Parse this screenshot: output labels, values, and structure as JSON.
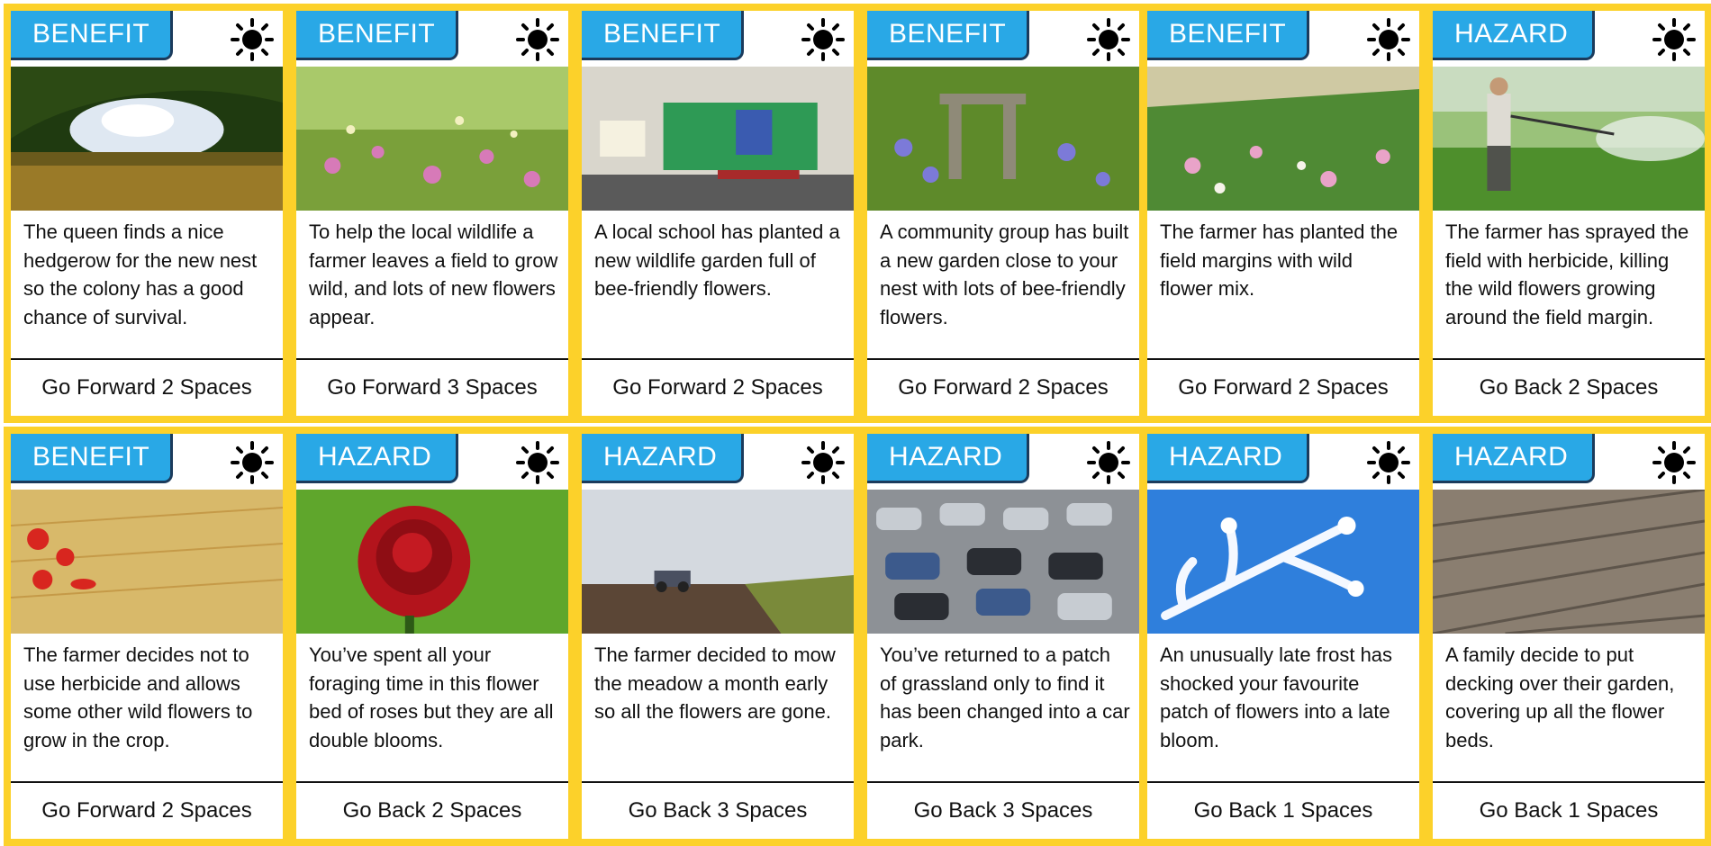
{
  "cards": [
    {
      "type": "BENEFIT",
      "text": "The queen finds a nice hedgerow for the new nest so the colony has a good chance of survival.",
      "action": "Go Forward 2 Spaces",
      "scene": "hedgerow"
    },
    {
      "type": "BENEFIT",
      "text": "To help the local wildlife a farmer leaves a field to grow wild, and lots of new flowers appear.",
      "action": "Go Forward 3 Spaces",
      "scene": "wildflowers"
    },
    {
      "type": "BENEFIT",
      "text": "A local school has planted a new wildlife garden full of bee-friendly flowers.",
      "action": "Go Forward 2 Spaces",
      "scene": "classroom"
    },
    {
      "type": "BENEFIT",
      "text": "A community group has built a new garden close to your nest with lots of bee-friendly flowers.",
      "action": "Go Forward 2 Spaces",
      "scene": "garden"
    },
    {
      "type": "BENEFIT",
      "text": "The farmer has planted the field margins with wild flower mix.",
      "action": "Go Forward 2 Spaces",
      "scene": "field-margin"
    },
    {
      "type": "HAZARD",
      "text": "The farmer has sprayed the field with herbicide, killing the wild flowers growing around the field margin.",
      "action": "Go Back 2 Spaces",
      "scene": "sprayer"
    },
    {
      "type": "BENEFIT",
      "text": "The farmer decides not to use herbicide and allows some other wild flowers to grow in the crop.",
      "action": "Go Forward 2 Spaces",
      "scene": "poppies"
    },
    {
      "type": "HAZARD",
      "text": "You’ve spent all your foraging time in this flower bed of roses but they are all double blooms.",
      "action": "Go Back 2 Spaces",
      "scene": "rose"
    },
    {
      "type": "HAZARD",
      "text": "The farmer decided to mow the meadow a month early so all the flowers are gone.",
      "action": "Go Back 3 Spaces",
      "scene": "tractor"
    },
    {
      "type": "HAZARD",
      "text": "You’ve returned to a patch of grassland only to find it has been changed into a car park.",
      "action": "Go Back 3 Spaces",
      "scene": "car-park"
    },
    {
      "type": "HAZARD",
      "text": "An unusually late frost has shocked your favourite patch of flowers into a late bloom.",
      "action": "Go Back 1 Spaces",
      "scene": "frost"
    },
    {
      "type": "HAZARD",
      "text": "A family decide to put decking over their garden, covering up all the flower beds.",
      "action": "Go Back 1 Spaces",
      "scene": "decking"
    }
  ],
  "icons": {
    "corner": "sun-icon"
  },
  "colors": {
    "border": "#fcd12a",
    "tag": "#29a8e6"
  }
}
